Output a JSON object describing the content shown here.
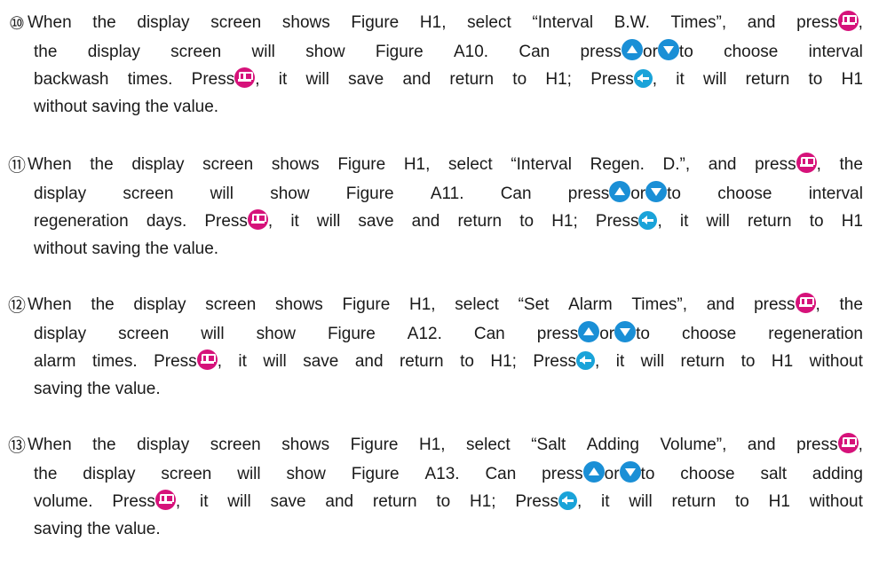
{
  "instructions": [
    {
      "number": "⑩",
      "lines": [
        [
          "When the display screen shows Figure H1, select “Interval B.W. Times”, and press",
          "enter",
          ","
        ],
        [
          "the display screen will show Figure A10. Can press",
          "up",
          "or",
          "down",
          "to choose interval"
        ],
        [
          "backwash times. Press",
          "enter",
          ", it will save and return to H1; Press",
          "back",
          ", it will return to H1"
        ],
        [
          "without saving the value."
        ]
      ]
    },
    {
      "number": "⑪",
      "lines": [
        [
          "When the display screen shows Figure H1, select “Interval Regen. D.”, and press",
          "enter",
          ", the"
        ],
        [
          "display screen will show Figure A11. Can press",
          "up",
          "or",
          "down",
          "to choose interval"
        ],
        [
          "regeneration days. Press",
          "enter",
          ", it will save and return to H1; Press",
          "back",
          ", it will return to H1"
        ],
        [
          "without saving the value."
        ]
      ]
    },
    {
      "number": "⑫",
      "lines": [
        [
          "When the display screen shows Figure H1, select “Set Alarm Times”, and press",
          "enter",
          ", the"
        ],
        [
          "display screen will show Figure A12. Can press",
          "up",
          "or",
          "down",
          "to choose regeneration"
        ],
        [
          "alarm times. Press",
          "enter",
          ", it will save and return to H1; Press",
          "back",
          ", it will return to H1 without"
        ],
        [
          "saving the value."
        ]
      ]
    },
    {
      "number": "⑬",
      "lines": [
        [
          "When the display screen shows Figure H1, select “Salt Adding Volume”, and press",
          "enter",
          ","
        ],
        [
          "the display screen will show Figure A13. Can press",
          "up",
          "or",
          "down",
          "to choose salt adding"
        ],
        [
          "volume. Press",
          "enter",
          ", it will save and return to H1; Press",
          "back",
          ", it will return to H1 without"
        ],
        [
          "saving the value."
        ]
      ]
    }
  ],
  "icons": {
    "enter": "enter-button-icon",
    "back": "back-button-icon",
    "up": "up-arrow-button-icon",
    "down": "down-arrow-button-icon"
  },
  "colors": {
    "enter": "#d6127a",
    "back": "#1aa3d9",
    "arrows": "#1a8fd6",
    "text": "#1a1a1a"
  }
}
